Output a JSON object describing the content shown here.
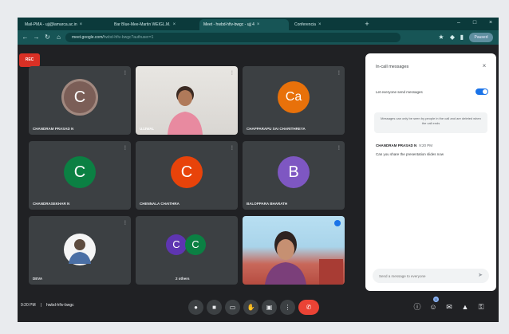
{
  "browser": {
    "tabs": [
      {
        "label": "Mail-PMA - ujj@lamarca.ac.in",
        "active": false
      },
      {
        "label": "Bar Blue-Mee-Martin WEIGL.M.",
        "active": false
      },
      {
        "label": "Meet - hwbd-hfiv-bwgc - ujj 4",
        "active": true
      },
      {
        "label": "Conferencia",
        "active": false
      }
    ],
    "new_tab": "+",
    "url": "meet.google.com/",
    "url_rest": "hwbd-hfiv-bwgc?authuser=1",
    "profile_label": "Paused"
  },
  "meeting": {
    "rec_label": "REC",
    "tiles": [
      {
        "name": "CHANDRAM PRASAD N",
        "initial": "C",
        "color": "#7b5e57",
        "ring": "#a1887f"
      },
      {
        "name": "UJJWAL",
        "initial": "",
        "color": "",
        "ring": ""
      },
      {
        "name": "CHAPPARAPU SAI CHARITHREYA",
        "initial": "Ca",
        "color": "#e8710a",
        "ring": ""
      },
      {
        "name": "CHANDRASEKHAR N",
        "initial": "C",
        "color": "#0b8043",
        "ring": ""
      },
      {
        "name": "CHENNALA CHAITHRA",
        "initial": "C",
        "color": "#e8430a",
        "ring": ""
      },
      {
        "name": "BALOPPARA BHARATH",
        "initial": "B",
        "color": "#7e57c2",
        "ring": ""
      },
      {
        "name": "DEVA",
        "initial": "",
        "color": "",
        "ring": ""
      },
      {
        "name": "2 others",
        "initial": "C",
        "color": "#5e35b1",
        "initial2": "C",
        "color2": "#0b8043"
      },
      {
        "name": "",
        "initial": "",
        "color": "",
        "ring": ""
      }
    ]
  },
  "controls": {
    "time": "9:20 PM",
    "sep": "|",
    "meeting_code": "hwbd-hfiv-bwgc",
    "buttons": [
      "mic-icon",
      "camera-icon",
      "captions-icon",
      "raise-hand-icon",
      "present-icon",
      "more-icon",
      "end-call-icon"
    ],
    "participants_count": "11"
  },
  "chat": {
    "title": "In-call messages",
    "close": "×",
    "toggle_label": "Let everyone send messages",
    "notice": "Messages can only be seen by people in the call and are deleted when the call ends",
    "sender": "CHANDRAM PRASAD N",
    "time": "9:20 PM",
    "message": "Can you share the presentation slides now",
    "input_placeholder": "Send a message to everyone",
    "send_icon": "send-icon"
  }
}
